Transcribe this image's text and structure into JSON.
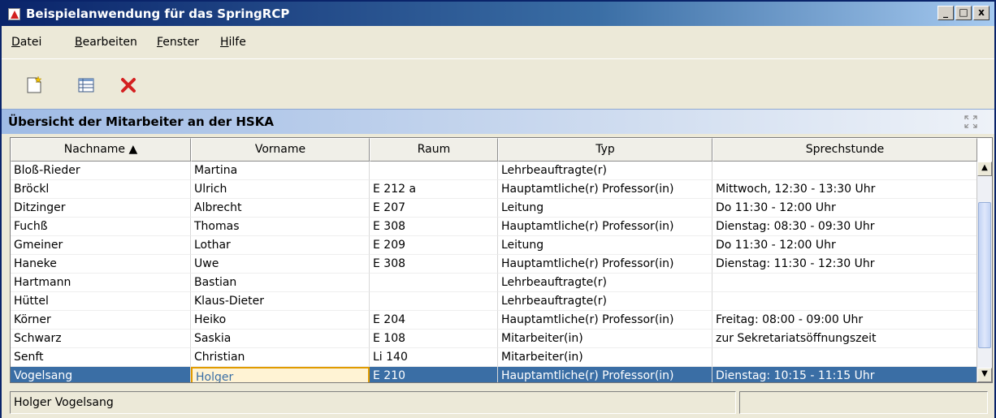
{
  "window": {
    "title": "Beispielanwendung für das SpringRCP",
    "buttons": [
      "_",
      "□",
      "x"
    ]
  },
  "menu": [
    {
      "label": "Datei",
      "mnemonic": "D",
      "rest": "atei"
    },
    {
      "label": "Bearbeiten",
      "mnemonic": "B",
      "rest": "earbeiten"
    },
    {
      "label": "Fenster",
      "mnemonic": "F",
      "rest": "enster"
    },
    {
      "label": "Hilfe",
      "mnemonic": "H",
      "rest": "ilfe"
    }
  ],
  "toolbar": {
    "icons": [
      "new-document-icon",
      "table-view-icon",
      "delete-icon"
    ]
  },
  "view": {
    "title": "Übersicht der Mitarbeiter an der HSKA"
  },
  "table": {
    "columns": [
      "Nachname ▲",
      "Vorname",
      "Raum",
      "Typ",
      "Sprechstunde"
    ],
    "rows": [
      [
        "Bloß-Rieder",
        "Martina",
        "",
        "Lehrbeauftragte(r)",
        ""
      ],
      [
        "Bröckl",
        "Ulrich",
        "E 212 a",
        "Hauptamtliche(r) Professor(in)",
        "Mittwoch, 12:30 - 13:30 Uhr"
      ],
      [
        "Ditzinger",
        "Albrecht",
        "E 207",
        "Leitung",
        "Do 11:30 - 12:00 Uhr"
      ],
      [
        "Fuchß",
        "Thomas",
        "E 308",
        "Hauptamtliche(r) Professor(in)",
        "Dienstag: 08:30 - 09:30 Uhr"
      ],
      [
        "Gmeiner",
        "Lothar",
        "E 209",
        "Leitung",
        "Do 11:30 - 12:00 Uhr"
      ],
      [
        "Haneke",
        "Uwe",
        "E 308",
        "Hauptamtliche(r) Professor(in)",
        "Dienstag: 11:30 - 12:30 Uhr"
      ],
      [
        "Hartmann",
        "Bastian",
        "",
        "Lehrbeauftragte(r)",
        ""
      ],
      [
        "Hüttel",
        "Klaus-Dieter",
        "",
        "Lehrbeauftragte(r)",
        ""
      ],
      [
        "Körner",
        "Heiko",
        "E 204",
        "Hauptamtliche(r) Professor(in)",
        "Freitag: 08:00 - 09:00 Uhr"
      ],
      [
        "Schwarz",
        "Saskia",
        "E 108",
        "Mitarbeiter(in)",
        "zur Sekretariatsöffnungszeit"
      ],
      [
        "Senft",
        "Christian",
        "Li 140",
        "Mitarbeiter(in)",
        ""
      ],
      [
        "Vogelsang",
        "Holger",
        "E 210",
        "Hauptamtliche(r) Professor(in)",
        "Dienstag: 10:15 - 11:15 Uhr"
      ]
    ],
    "selected_row": 11
  },
  "status": {
    "text": "Holger Vogelsang"
  },
  "colors": {
    "title_bar": "#0a246a",
    "selection": "#3a6ea5",
    "focus_border": "#e19b00"
  }
}
